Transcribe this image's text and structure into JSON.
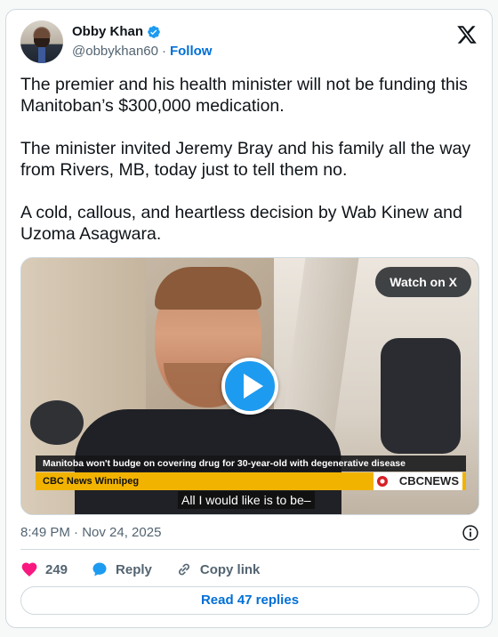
{
  "author": {
    "display_name": "Obby Khan",
    "handle": "@obbykhan60",
    "separator": "·",
    "follow_label": "Follow"
  },
  "tweet": {
    "text": "The premier and his health minister will not be funding this Manitoban’s $300,000 medication.\n\nThe minister invited Jeremy Bray and his family all the way from Rivers, MB, today just to tell them no.\n\nA cold, callous, and heartless decision by Wab Kinew and Uzoma Asagwara."
  },
  "media": {
    "watch_label": "Watch on X",
    "headline": "Manitoba won't budge on covering drug for 30-year-old with degenerative disease",
    "station": "CBC News Winnipeg",
    "network_logo": "CBCNEWS",
    "caption": "All I would like is to be–"
  },
  "meta": {
    "timestamp": "8:49 PM · Nov 24, 2025"
  },
  "actions": {
    "like_count": "249",
    "reply_label": "Reply",
    "copy_link_label": "Copy link"
  },
  "footer": {
    "read_replies_label": "Read 47 replies"
  },
  "colors": {
    "brand_blue": "#1d9bf0",
    "link_blue": "#006fd6",
    "like_pink": "#f91880",
    "muted": "#536471",
    "news_yellow": "#f2b300"
  },
  "icons": [
    "verified-badge-icon",
    "x-logo-icon",
    "play-icon",
    "info-icon",
    "heart-icon",
    "reply-bubble-icon",
    "link-icon"
  ]
}
